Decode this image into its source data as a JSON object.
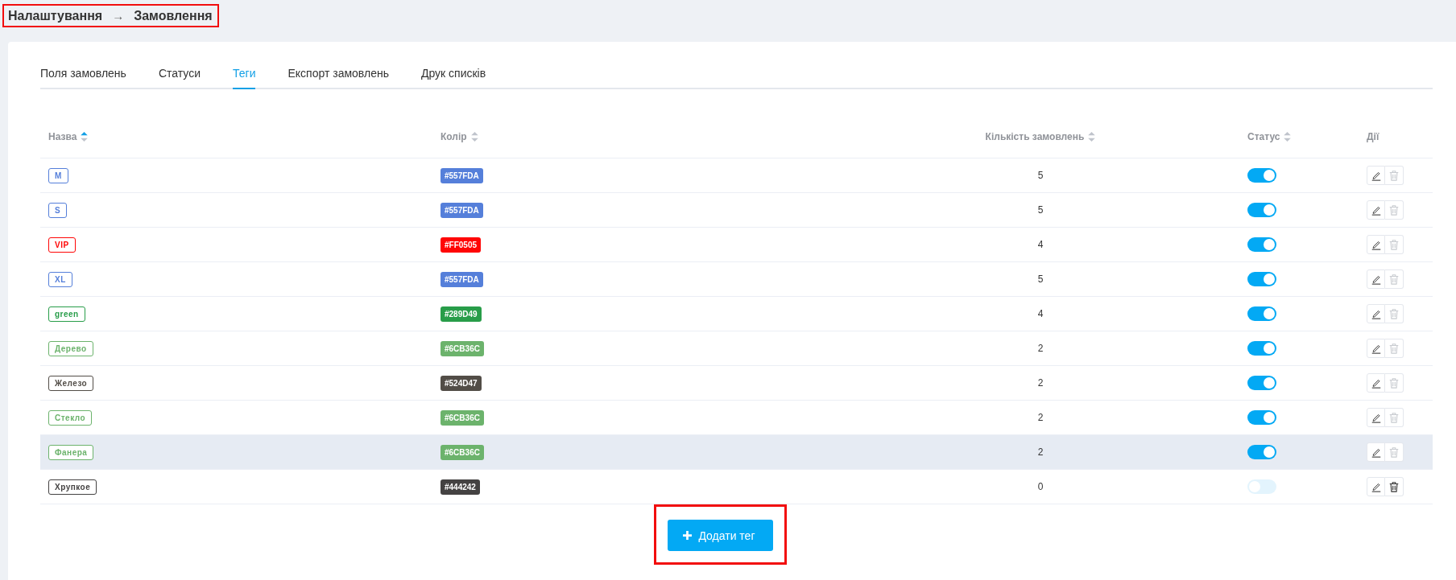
{
  "breadcrumb": {
    "parent": "Налаштування",
    "separator": "→",
    "current": "Замовлення"
  },
  "tabs": [
    {
      "label": "Поля замовлень",
      "selected": false
    },
    {
      "label": "Статуси",
      "selected": false
    },
    {
      "label": "Теги",
      "selected": true
    },
    {
      "label": "Експорт замовлень",
      "selected": false
    },
    {
      "label": "Друк списків",
      "selected": false
    }
  ],
  "table": {
    "columns": [
      {
        "label": "Назва",
        "sortable": true,
        "sorted": true
      },
      {
        "label": "Колір",
        "sortable": true,
        "sorted": false
      },
      {
        "label": "Кількість замовлень",
        "sortable": true,
        "sorted": false
      },
      {
        "label": "Статус",
        "sortable": true,
        "sorted": false
      },
      {
        "label": "Дії"
      }
    ],
    "rows": [
      {
        "name": "M",
        "color": "#557fda",
        "hex": "#557FDA",
        "orders": "5",
        "on": true,
        "hovered": false,
        "delete_disabled": true
      },
      {
        "name": "S",
        "color": "#557fda",
        "hex": "#557FDA",
        "orders": "5",
        "on": true,
        "hovered": false,
        "delete_disabled": true
      },
      {
        "name": "VIP",
        "color": "#ff0505",
        "hex": "#FF0505",
        "orders": "4",
        "on": true,
        "hovered": false,
        "delete_disabled": true
      },
      {
        "name": "XL",
        "color": "#557fda",
        "hex": "#557FDA",
        "orders": "5",
        "on": true,
        "hovered": false,
        "delete_disabled": true
      },
      {
        "name": "green",
        "color": "#289d49",
        "hex": "#289D49",
        "orders": "4",
        "on": true,
        "hovered": false,
        "delete_disabled": true
      },
      {
        "name": "Дерево",
        "color": "#6cb36c",
        "hex": "#6CB36C",
        "orders": "2",
        "on": true,
        "hovered": false,
        "delete_disabled": true
      },
      {
        "name": "Железо",
        "color": "#524d47",
        "hex": "#524D47",
        "orders": "2",
        "on": true,
        "hovered": false,
        "delete_disabled": true
      },
      {
        "name": "Стекло",
        "color": "#6cb36c",
        "hex": "#6CB36C",
        "orders": "2",
        "on": true,
        "hovered": false,
        "delete_disabled": true
      },
      {
        "name": "Фанера",
        "color": "#6cb36c",
        "hex": "#6CB36C",
        "orders": "2",
        "on": true,
        "hovered": true,
        "delete_disabled": true
      },
      {
        "name": "Хрупкое",
        "color": "#444242",
        "hex": "#444242",
        "orders": "0",
        "on": false,
        "hovered": false,
        "delete_disabled": false
      }
    ]
  },
  "add_button": {
    "label": "Додати тег"
  }
}
